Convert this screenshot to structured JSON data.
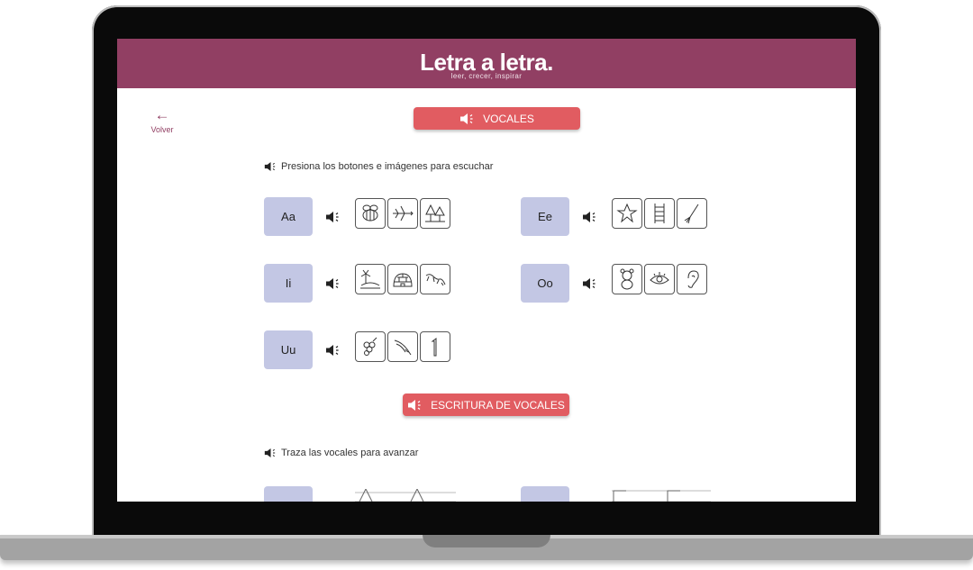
{
  "app": {
    "brand": "Letra a letra.",
    "tagline": "leer, crecer, inspirar",
    "back_label": "Volver"
  },
  "section_vocales": {
    "title": "VOCALES",
    "instruction": "Presiona los botones e imágenes para escuchar"
  },
  "vowels": [
    {
      "label": "Aa",
      "images": [
        "bee-icon",
        "airplane-icon",
        "trees-icon"
      ]
    },
    {
      "label": "Ee",
      "images": [
        "star-icon",
        "ladder-icon",
        "broom-icon"
      ]
    },
    {
      "label": "Ii",
      "images": [
        "island-icon",
        "igloo-icon",
        "iguana-icon"
      ]
    },
    {
      "label": "Oo",
      "images": [
        "teddy-bear-icon",
        "eye-icon",
        "ear-icon"
      ]
    },
    {
      "label": "Uu",
      "images": [
        "grapes-icon",
        "fingernail-icon",
        "number-one-icon"
      ]
    }
  ],
  "section_escritura": {
    "title": "ESCRITURA DE VOCALES",
    "instruction": "Traza las vocales para avanzar"
  },
  "colors": {
    "header": "#913f63",
    "accent_pill": "#e15c61",
    "vowel_button": "#c3c7e4"
  }
}
